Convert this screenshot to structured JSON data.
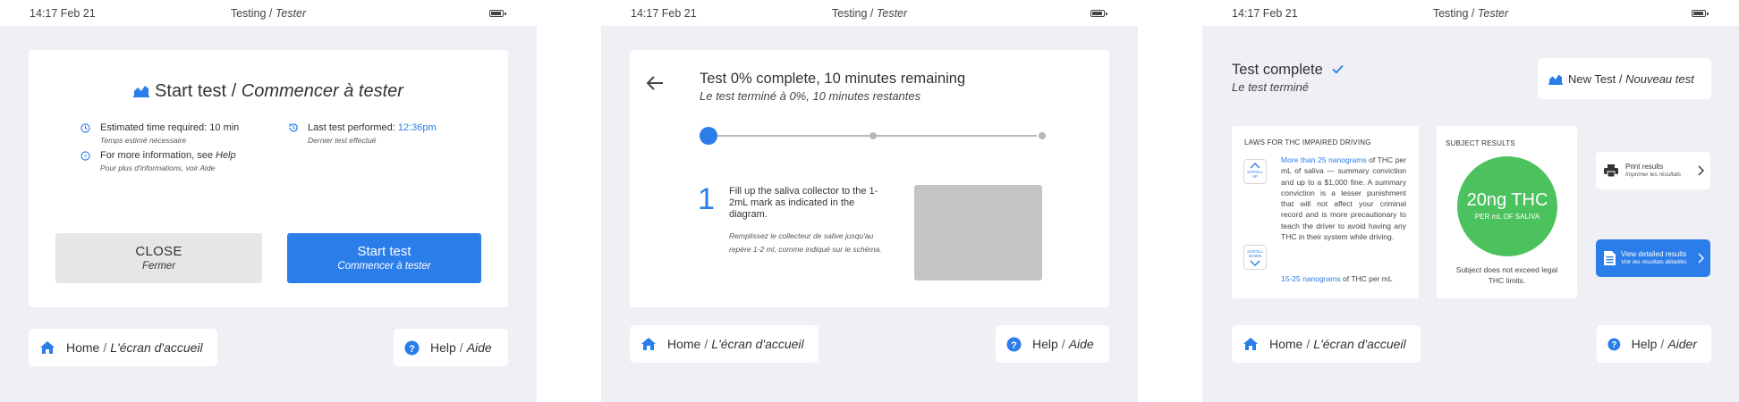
{
  "status": {
    "time": "14:17 Feb 21",
    "title_main": "Testing",
    "title_sep": "/",
    "title_sub": "Tester"
  },
  "nav": {
    "home": "Home",
    "home_fr": "L'écran d'accueil",
    "sep": "/",
    "help": "Help",
    "help_fr": "Aide",
    "help_fr_alt": "Aider"
  },
  "screen1": {
    "title": "Start test",
    "title_sep": "/",
    "title_fr": "Commencer à tester",
    "est_time": "Estimated time required: 10 min",
    "est_time_fr": "Temps estimé nécessaire",
    "info_prefix": "For more information, see",
    "info_link": "Help",
    "info_fr": "Pour plus d'informations, voir Aide",
    "last_test_prefix": "Last test performed:",
    "last_test_time": "12:36pm",
    "last_test_fr": "Dernier test effectué",
    "close": "CLOSE",
    "close_fr": "Fermer",
    "start": "Start test",
    "start_fr": "Commencer à tester"
  },
  "screen2": {
    "title": "Test 0% complete, 10 minutes remaining",
    "title_fr": "Le test terminé à 0%, 10 minutes restantes",
    "progress": 0,
    "step_number": "1",
    "step_text": "Fill up the saliva collector to the 1-2mL mark as indicated in the diagram.",
    "step_text_fr": "Remplissez le collecteur de salive jusqu'au repère 1-2 ml, comme indiqué sur le schéma."
  },
  "screen3": {
    "title": "Test complete",
    "title_fr": "Le test terminé",
    "new_test": "New Test",
    "new_test_sep": "/",
    "new_test_fr": "Nouveau test",
    "laws_header": "LAWS FOR THC IMPAIRED DRIVING",
    "scroll_up": "SCROLL UP",
    "scroll_down": "SCROLL DOWN",
    "law1_link": "More than 25 nanograms",
    "law1_tail": "of THC per mL of saliva",
    "law1_body": "— summary conviction and up to a $1,000 fine. A summary conviction is a lesser punishment that will not affect your criminal record and is more precautionary to teach the driver to avoid having any THC in their system while driving.",
    "law2_link": "15-25 nanograms",
    "law2_tail": "of THC per mL",
    "results_header": "SUBJECT RESULTS",
    "result_value": "20ng THC",
    "result_unit": "PER mL OF SALIVA",
    "result_note": "Subject does not exceed legal THC limits.",
    "print": "Print results",
    "print_fr": "Imprimer les résultats",
    "view": "View detailed results",
    "view_fr": "Voir les résultats détaillés"
  },
  "colors": {
    "accent": "#2b7de9",
    "result_green": "#4cc25e",
    "close_bg": "#e6e6e6",
    "placeholder": "#c4c4c4"
  }
}
